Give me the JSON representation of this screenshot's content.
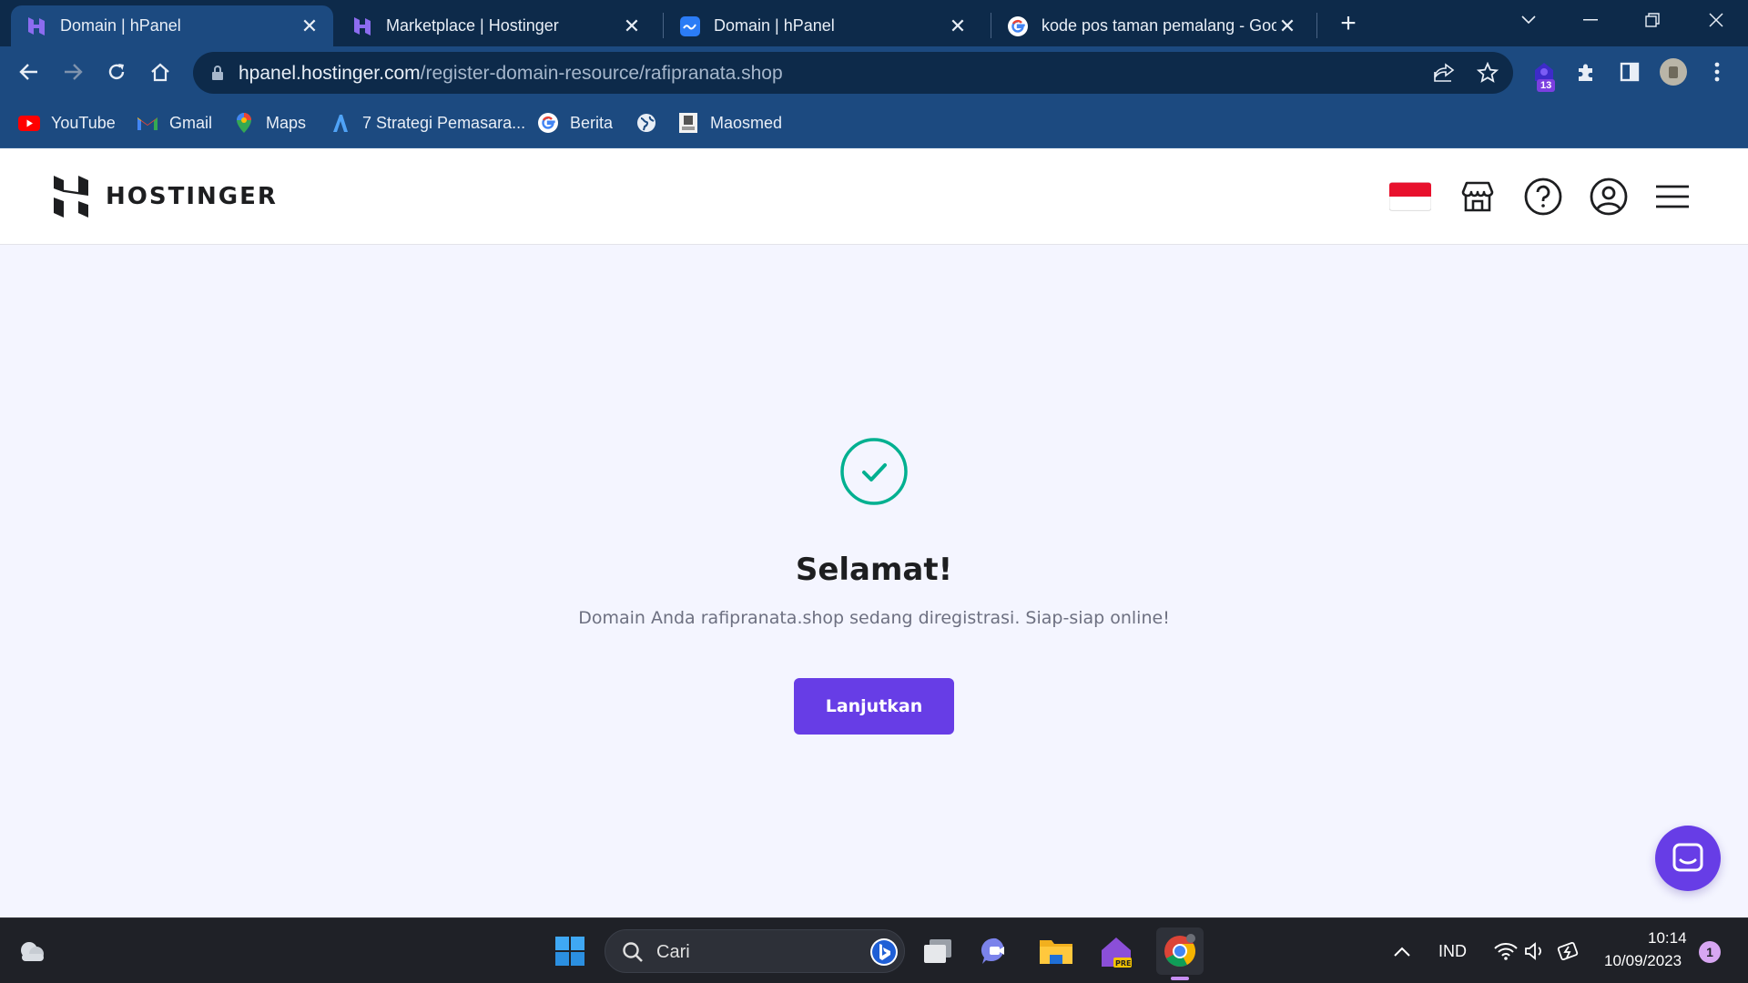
{
  "browser": {
    "tabs": [
      {
        "title": "Domain | hPanel",
        "active": true,
        "favicon": "hostinger-icon"
      },
      {
        "title": "Marketplace | Hostinger",
        "active": false,
        "favicon": "hostinger-icon"
      },
      {
        "title": "Domain | hPanel",
        "active": false,
        "favicon": "hpanel-blue-icon"
      },
      {
        "title": "kode pos taman pemalang - Goo",
        "active": false,
        "favicon": "google-icon"
      }
    ],
    "url_domain": "hpanel.hostinger.com",
    "url_path": "/register-domain-resource/rafipranata.shop",
    "extension_badge": "13",
    "bookmarks": [
      {
        "label": "YouTube",
        "icon": "youtube-icon"
      },
      {
        "label": "Gmail",
        "icon": "gmail-icon"
      },
      {
        "label": "Maps",
        "icon": "maps-icon"
      },
      {
        "label": "7 Strategi Pemasara...",
        "icon": "bookmark-a-icon"
      },
      {
        "label": "Berita",
        "icon": "google-icon"
      },
      {
        "label": "",
        "icon": "globe-icon"
      },
      {
        "label": "Maosmed",
        "icon": "maosmed-icon"
      }
    ]
  },
  "header": {
    "brand": "HOSTINGER",
    "icons": [
      "indonesia-flag-icon",
      "store-icon",
      "help-icon",
      "account-icon",
      "menu-icon"
    ]
  },
  "main": {
    "heading": "Selamat!",
    "message": "Domain Anda rafipranata.shop sedang diregistrasi. Siap-siap online!",
    "button_label": "Lanjutkan",
    "colors": {
      "primary": "#673de6",
      "success": "#00b090",
      "background": "#f4f5ff"
    }
  },
  "taskbar": {
    "search_placeholder": "Cari",
    "language": "IND",
    "time": "10:14",
    "date": "10/09/2023",
    "notification_count": "1"
  }
}
